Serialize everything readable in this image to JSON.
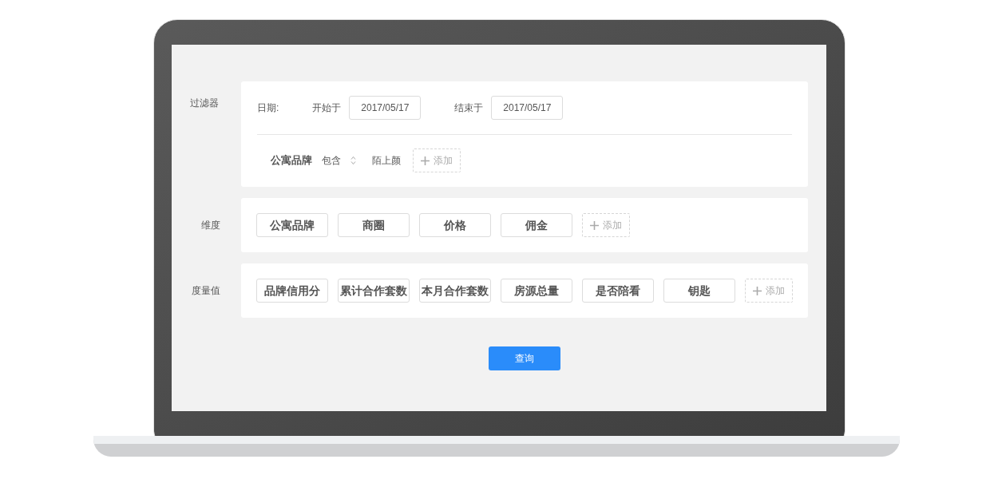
{
  "filter": {
    "label": "过滤器",
    "date_label": "日期:",
    "start_label": "开始于",
    "start_value": "2017/05/17",
    "end_label": "结束于",
    "end_value": "2017/05/17",
    "conditions": [
      {
        "field": "公寓品牌",
        "operator": "包含",
        "value": "陌上颜"
      }
    ],
    "add_label": "添加"
  },
  "dimensions": {
    "label": "维度",
    "chips": [
      "公寓品牌",
      "商圈",
      "价格",
      "佣金"
    ],
    "add_label": "添加"
  },
  "measures": {
    "label": "度量值",
    "chips": [
      "品牌信用分",
      "累计合作套数",
      "本月合作套数",
      "房源总量",
      "是否陪看",
      "钥匙"
    ],
    "add_label": "添加"
  },
  "query_button": "查询"
}
